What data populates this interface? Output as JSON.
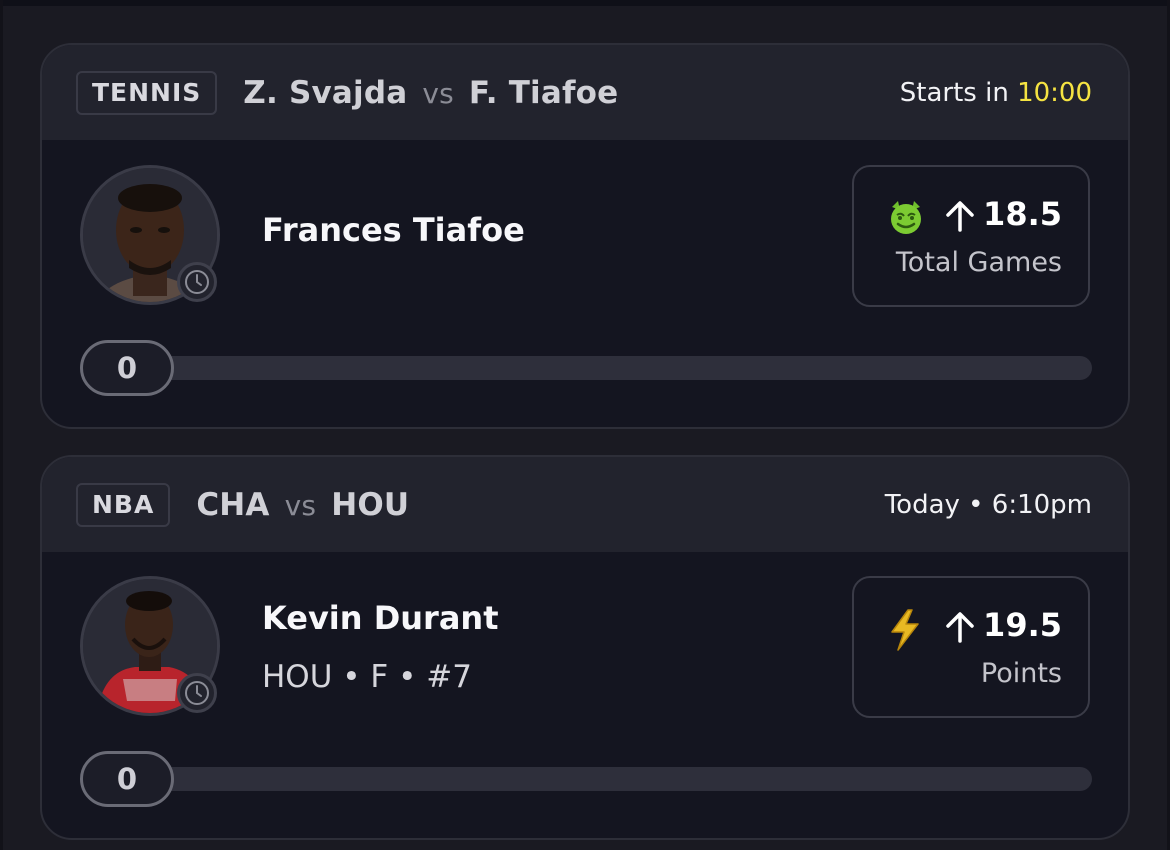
{
  "cards": [
    {
      "league": "TENNIS",
      "team1": "Z. Svajda",
      "vs": "vs",
      "team2": "F. Tiafoe",
      "time_prefix": "Starts in",
      "time_value": "10:00",
      "player_name": "Frances Tiafoe",
      "player_info": "",
      "pick_icon": "devil-emoji-icon",
      "pick_direction": "over",
      "line": "18.5",
      "stat": "Total Games",
      "progress_value": "0"
    },
    {
      "league": "NBA",
      "team1": "CHA",
      "vs": "vs",
      "team2": "HOU",
      "time_prefix": "Today • 6:10pm",
      "time_value": "",
      "player_name": "Kevin Durant",
      "player_info": "HOU • F • #7",
      "pick_icon": "lightning-bolt-icon",
      "pick_direction": "over",
      "line": "19.5",
      "stat": "Points",
      "progress_value": "0"
    }
  ],
  "colors": {
    "background": "#1a1a22",
    "card_header": "#22232d",
    "card_body": "#141520",
    "timer": "#f5e342",
    "track": "#2e2f3b"
  }
}
